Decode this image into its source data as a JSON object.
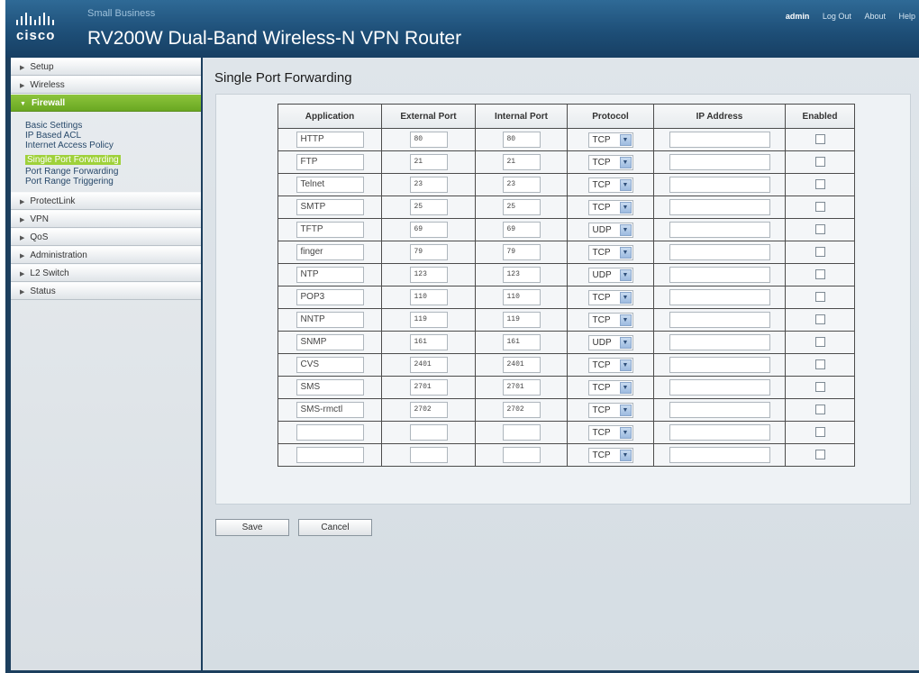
{
  "header": {
    "logo": "cisco",
    "brand": "Small Business",
    "product": "RV200W Dual-Band Wireless-N VPN Router",
    "user": "admin",
    "links": [
      "Log Out",
      "About",
      "Help"
    ]
  },
  "sidebar": {
    "items_top": [
      "Setup",
      "Wireless",
      "Firewall"
    ],
    "firewall_sub": [
      "Basic Settings",
      "IP Based ACL",
      "Internet Access Policy",
      "Single Port Forwarding",
      "Port Range Forwarding",
      "Port Range Triggering"
    ],
    "items_bottom": [
      "ProtectLink",
      "VPN",
      "QoS",
      "Administration",
      "L2 Switch",
      "Status"
    ]
  },
  "page": {
    "title": "Single Port Forwarding",
    "columns": [
      "Application",
      "External Port",
      "Internal Port",
      "Protocol",
      "IP Address",
      "Enabled"
    ],
    "rows": [
      {
        "app": "HTTP",
        "ext": "80",
        "int": "80",
        "proto": "TCP",
        "ip": "",
        "enabled": false
      },
      {
        "app": "FTP",
        "ext": "21",
        "int": "21",
        "proto": "TCP",
        "ip": "",
        "enabled": false
      },
      {
        "app": "Telnet",
        "ext": "23",
        "int": "23",
        "proto": "TCP",
        "ip": "",
        "enabled": false
      },
      {
        "app": "SMTP",
        "ext": "25",
        "int": "25",
        "proto": "TCP",
        "ip": "",
        "enabled": false
      },
      {
        "app": "TFTP",
        "ext": "69",
        "int": "69",
        "proto": "UDP",
        "ip": "",
        "enabled": false
      },
      {
        "app": "finger",
        "ext": "79",
        "int": "79",
        "proto": "TCP",
        "ip": "",
        "enabled": false
      },
      {
        "app": "NTP",
        "ext": "123",
        "int": "123",
        "proto": "UDP",
        "ip": "",
        "enabled": false
      },
      {
        "app": "POP3",
        "ext": "110",
        "int": "110",
        "proto": "TCP",
        "ip": "",
        "enabled": false
      },
      {
        "app": "NNTP",
        "ext": "119",
        "int": "119",
        "proto": "TCP",
        "ip": "",
        "enabled": false
      },
      {
        "app": "SNMP",
        "ext": "161",
        "int": "161",
        "proto": "UDP",
        "ip": "",
        "enabled": false
      },
      {
        "app": "CVS",
        "ext": "2401",
        "int": "2401",
        "proto": "TCP",
        "ip": "",
        "enabled": false
      },
      {
        "app": "SMS",
        "ext": "2701",
        "int": "2701",
        "proto": "TCP",
        "ip": "",
        "enabled": false
      },
      {
        "app": "SMS-rmctl",
        "ext": "2702",
        "int": "2702",
        "proto": "TCP",
        "ip": "",
        "enabled": false
      },
      {
        "app": "",
        "ext": "",
        "int": "",
        "proto": "TCP",
        "ip": "",
        "enabled": false
      },
      {
        "app": "",
        "ext": "",
        "int": "",
        "proto": "TCP",
        "ip": "",
        "enabled": false
      }
    ],
    "save_label": "Save",
    "cancel_label": "Cancel"
  },
  "colors": {
    "header_blue": "#1e4f78",
    "nav_active_green": "#78b52c",
    "subnav_highlight": "#9fd13a"
  }
}
